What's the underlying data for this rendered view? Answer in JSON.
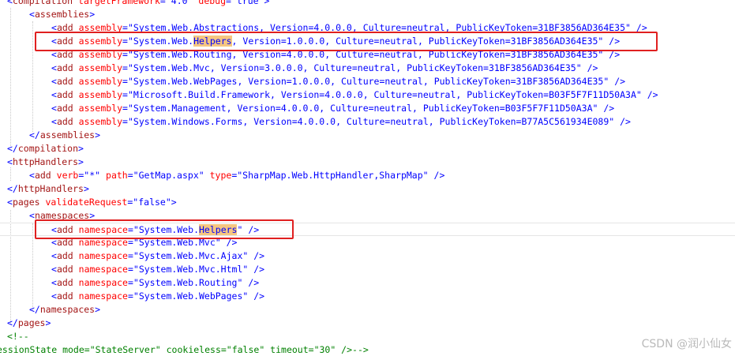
{
  "editor": {
    "lines": [
      {
        "indent": 0,
        "tokens": [
          {
            "t": "bracket",
            "v": "<"
          },
          {
            "t": "tag",
            "v": "compilation"
          },
          {
            "t": "plain",
            "v": " "
          },
          {
            "t": "attr",
            "v": "targetFramework"
          },
          {
            "t": "eq",
            "v": "="
          },
          {
            "t": "val",
            "v": "\"4.0\""
          },
          {
            "t": "plain",
            "v": " "
          },
          {
            "t": "attr",
            "v": "debug"
          },
          {
            "t": "eq",
            "v": "="
          },
          {
            "t": "val",
            "v": "\"true\""
          },
          {
            "t": "bracket",
            "v": ">"
          }
        ]
      },
      {
        "indent": 1,
        "tokens": [
          {
            "t": "bracket",
            "v": "<"
          },
          {
            "t": "tag",
            "v": "assemblies"
          },
          {
            "t": "bracket",
            "v": ">"
          }
        ]
      },
      {
        "indent": 2,
        "tokens": [
          {
            "t": "bracket",
            "v": "<"
          },
          {
            "t": "tag",
            "v": "add"
          },
          {
            "t": "plain",
            "v": " "
          },
          {
            "t": "attr",
            "v": "assembly"
          },
          {
            "t": "eq",
            "v": "="
          },
          {
            "t": "val",
            "v": "\"System.Web.Abstractions, Version=4.0.0.0, Culture=neutral, PublicKeyToken=31BF3856AD364E35\""
          },
          {
            "t": "plain",
            "v": " "
          },
          {
            "t": "bracket",
            "v": "/>"
          }
        ]
      },
      {
        "indent": 2,
        "tokens": [
          {
            "t": "bracket",
            "v": "<"
          },
          {
            "t": "tag",
            "v": "add"
          },
          {
            "t": "plain",
            "v": " "
          },
          {
            "t": "attr",
            "v": "assembly"
          },
          {
            "t": "eq",
            "v": "="
          },
          {
            "t": "val",
            "v": "\"System.Web."
          },
          {
            "t": "hl",
            "v": "Helpers"
          },
          {
            "t": "val",
            "v": ", Version=1.0.0.0, Culture=neutral, PublicKeyToken=31BF3856AD364E35\""
          },
          {
            "t": "plain",
            "v": " "
          },
          {
            "t": "bracket",
            "v": "/>"
          }
        ]
      },
      {
        "indent": 2,
        "tokens": [
          {
            "t": "bracket",
            "v": "<"
          },
          {
            "t": "tag",
            "v": "add"
          },
          {
            "t": "plain",
            "v": " "
          },
          {
            "t": "attr",
            "v": "assembly"
          },
          {
            "t": "eq",
            "v": "="
          },
          {
            "t": "val",
            "v": "\"System.Web.Routing, Version=4.0.0.0, Culture=neutral, PublicKeyToken=31BF3856AD364E35\""
          },
          {
            "t": "plain",
            "v": " "
          },
          {
            "t": "bracket",
            "v": "/>"
          }
        ]
      },
      {
        "indent": 2,
        "tokens": [
          {
            "t": "bracket",
            "v": "<"
          },
          {
            "t": "tag",
            "v": "add"
          },
          {
            "t": "plain",
            "v": " "
          },
          {
            "t": "attr",
            "v": "assembly"
          },
          {
            "t": "eq",
            "v": "="
          },
          {
            "t": "val",
            "v": "\"System.Web.Mvc, Version=3.0.0.0, Culture=neutral, PublicKeyToken=31BF3856AD364E35\""
          },
          {
            "t": "plain",
            "v": " "
          },
          {
            "t": "bracket",
            "v": "/>"
          }
        ]
      },
      {
        "indent": 2,
        "tokens": [
          {
            "t": "bracket",
            "v": "<"
          },
          {
            "t": "tag",
            "v": "add"
          },
          {
            "t": "plain",
            "v": " "
          },
          {
            "t": "attr",
            "v": "assembly"
          },
          {
            "t": "eq",
            "v": "="
          },
          {
            "t": "val",
            "v": "\"System.Web.WebPages, Version=1.0.0.0, Culture=neutral, PublicKeyToken=31BF3856AD364E35\""
          },
          {
            "t": "plain",
            "v": " "
          },
          {
            "t": "bracket",
            "v": "/>"
          }
        ]
      },
      {
        "indent": 2,
        "tokens": [
          {
            "t": "bracket",
            "v": "<"
          },
          {
            "t": "tag",
            "v": "add"
          },
          {
            "t": "plain",
            "v": " "
          },
          {
            "t": "attr",
            "v": "assembly"
          },
          {
            "t": "eq",
            "v": "="
          },
          {
            "t": "val",
            "v": "\"Microsoft.Build.Framework, Version=4.0.0.0, Culture=neutral, PublicKeyToken=B03F5F7F11D50A3A\""
          },
          {
            "t": "plain",
            "v": " "
          },
          {
            "t": "bracket",
            "v": "/>"
          }
        ]
      },
      {
        "indent": 2,
        "tokens": [
          {
            "t": "bracket",
            "v": "<"
          },
          {
            "t": "tag",
            "v": "add"
          },
          {
            "t": "plain",
            "v": " "
          },
          {
            "t": "attr",
            "v": "assembly"
          },
          {
            "t": "eq",
            "v": "="
          },
          {
            "t": "val",
            "v": "\"System.Management, Version=4.0.0.0, Culture=neutral, PublicKeyToken=B03F5F7F11D50A3A\""
          },
          {
            "t": "plain",
            "v": " "
          },
          {
            "t": "bracket",
            "v": "/>"
          }
        ]
      },
      {
        "indent": 2,
        "tokens": [
          {
            "t": "bracket",
            "v": "<"
          },
          {
            "t": "tag",
            "v": "add"
          },
          {
            "t": "plain",
            "v": " "
          },
          {
            "t": "attr",
            "v": "assembly"
          },
          {
            "t": "eq",
            "v": "="
          },
          {
            "t": "val",
            "v": "\"System.Windows.Forms, Version=4.0.0.0, Culture=neutral, PublicKeyToken=B77A5C561934E089\""
          },
          {
            "t": "plain",
            "v": " "
          },
          {
            "t": "bracket",
            "v": "/>"
          }
        ]
      },
      {
        "indent": 1,
        "tokens": [
          {
            "t": "bracket",
            "v": "</"
          },
          {
            "t": "tag",
            "v": "assemblies"
          },
          {
            "t": "bracket",
            "v": ">"
          }
        ]
      },
      {
        "indent": 0,
        "tokens": [
          {
            "t": "bracket",
            "v": "</"
          },
          {
            "t": "tag",
            "v": "compilation"
          },
          {
            "t": "bracket",
            "v": ">"
          }
        ]
      },
      {
        "indent": 0,
        "tokens": [
          {
            "t": "bracket",
            "v": "<"
          },
          {
            "t": "tag",
            "v": "httpHandlers"
          },
          {
            "t": "bracket",
            "v": ">"
          }
        ]
      },
      {
        "indent": 1,
        "tokens": [
          {
            "t": "bracket",
            "v": "<"
          },
          {
            "t": "tag",
            "v": "add"
          },
          {
            "t": "plain",
            "v": " "
          },
          {
            "t": "attr",
            "v": "verb"
          },
          {
            "t": "eq",
            "v": "="
          },
          {
            "t": "val",
            "v": "\"*\""
          },
          {
            "t": "plain",
            "v": " "
          },
          {
            "t": "attr",
            "v": "path"
          },
          {
            "t": "eq",
            "v": "="
          },
          {
            "t": "val",
            "v": "\"GetMap.aspx\""
          },
          {
            "t": "plain",
            "v": " "
          },
          {
            "t": "attr",
            "v": "type"
          },
          {
            "t": "eq",
            "v": "="
          },
          {
            "t": "val",
            "v": "\"SharpMap.Web.HttpHandler,SharpMap\""
          },
          {
            "t": "plain",
            "v": " "
          },
          {
            "t": "bracket",
            "v": "/>"
          }
        ]
      },
      {
        "indent": 0,
        "tokens": [
          {
            "t": "bracket",
            "v": "</"
          },
          {
            "t": "tag",
            "v": "httpHandlers"
          },
          {
            "t": "bracket",
            "v": ">"
          }
        ]
      },
      {
        "indent": 0,
        "tokens": [
          {
            "t": "bracket",
            "v": "<"
          },
          {
            "t": "tag",
            "v": "pages"
          },
          {
            "t": "plain",
            "v": " "
          },
          {
            "t": "attr",
            "v": "validateRequest"
          },
          {
            "t": "eq",
            "v": "="
          },
          {
            "t": "val",
            "v": "\"false\""
          },
          {
            "t": "bracket",
            "v": ">"
          }
        ]
      },
      {
        "indent": 1,
        "tokens": [
          {
            "t": "bracket",
            "v": "<"
          },
          {
            "t": "tag",
            "v": "namespaces"
          },
          {
            "t": "bracket",
            "v": ">"
          }
        ]
      },
      {
        "indent": 2,
        "current": true,
        "tokens": [
          {
            "t": "bracket",
            "v": "<"
          },
          {
            "t": "tag",
            "v": "add"
          },
          {
            "t": "plain",
            "v": " "
          },
          {
            "t": "attr",
            "v": "namespace"
          },
          {
            "t": "eq",
            "v": "="
          },
          {
            "t": "val",
            "v": "\"System.Web."
          },
          {
            "t": "hl",
            "v": "Helpers"
          },
          {
            "t": "val",
            "v": "\""
          },
          {
            "t": "plain",
            "v": " "
          },
          {
            "t": "bracket",
            "v": "/>"
          }
        ]
      },
      {
        "indent": 2,
        "tokens": [
          {
            "t": "bracket",
            "v": "<"
          },
          {
            "t": "tag",
            "v": "add"
          },
          {
            "t": "plain",
            "v": " "
          },
          {
            "t": "attr",
            "v": "namespace"
          },
          {
            "t": "eq",
            "v": "="
          },
          {
            "t": "val",
            "v": "\"System.Web.Mvc\""
          },
          {
            "t": "plain",
            "v": " "
          },
          {
            "t": "bracket",
            "v": "/>"
          }
        ]
      },
      {
        "indent": 2,
        "tokens": [
          {
            "t": "bracket",
            "v": "<"
          },
          {
            "t": "tag",
            "v": "add"
          },
          {
            "t": "plain",
            "v": " "
          },
          {
            "t": "attr",
            "v": "namespace"
          },
          {
            "t": "eq",
            "v": "="
          },
          {
            "t": "val",
            "v": "\"System.Web.Mvc.Ajax\""
          },
          {
            "t": "plain",
            "v": " "
          },
          {
            "t": "bracket",
            "v": "/>"
          }
        ]
      },
      {
        "indent": 2,
        "tokens": [
          {
            "t": "bracket",
            "v": "<"
          },
          {
            "t": "tag",
            "v": "add"
          },
          {
            "t": "plain",
            "v": " "
          },
          {
            "t": "attr",
            "v": "namespace"
          },
          {
            "t": "eq",
            "v": "="
          },
          {
            "t": "val",
            "v": "\"System.Web.Mvc.Html\""
          },
          {
            "t": "plain",
            "v": " "
          },
          {
            "t": "bracket",
            "v": "/>"
          }
        ]
      },
      {
        "indent": 2,
        "tokens": [
          {
            "t": "bracket",
            "v": "<"
          },
          {
            "t": "tag",
            "v": "add"
          },
          {
            "t": "plain",
            "v": " "
          },
          {
            "t": "attr",
            "v": "namespace"
          },
          {
            "t": "eq",
            "v": "="
          },
          {
            "t": "val",
            "v": "\"System.Web.Routing\""
          },
          {
            "t": "plain",
            "v": " "
          },
          {
            "t": "bracket",
            "v": "/>"
          }
        ]
      },
      {
        "indent": 2,
        "tokens": [
          {
            "t": "bracket",
            "v": "<"
          },
          {
            "t": "tag",
            "v": "add"
          },
          {
            "t": "plain",
            "v": " "
          },
          {
            "t": "attr",
            "v": "namespace"
          },
          {
            "t": "eq",
            "v": "="
          },
          {
            "t": "val",
            "v": "\"System.Web.WebPages\""
          },
          {
            "t": "plain",
            "v": " "
          },
          {
            "t": "bracket",
            "v": "/>"
          }
        ]
      },
      {
        "indent": 1,
        "tokens": [
          {
            "t": "bracket",
            "v": "</"
          },
          {
            "t": "tag",
            "v": "namespaces"
          },
          {
            "t": "bracket",
            "v": ">"
          }
        ]
      },
      {
        "indent": 0,
        "tokens": [
          {
            "t": "bracket",
            "v": "</"
          },
          {
            "t": "tag",
            "v": "pages"
          },
          {
            "t": "bracket",
            "v": ">"
          }
        ]
      },
      {
        "indent": 0,
        "tokens": [
          {
            "t": "comment",
            "v": "<!--"
          }
        ]
      },
      {
        "indent": -1,
        "tokens": [
          {
            "t": "comment",
            "v": "essionState mode=\"StateServer\" cookieless=\"false\" timeout=\"30\" />-->"
          }
        ]
      }
    ]
  },
  "watermark": "CSDN @润小仙女",
  "colors": {
    "tag": "#a31515",
    "attribute": "#ff0000",
    "value": "#0000ff",
    "bracket": "#0000ff",
    "comment": "#008000",
    "highlight": "#f6c681",
    "box": "#e02020"
  }
}
